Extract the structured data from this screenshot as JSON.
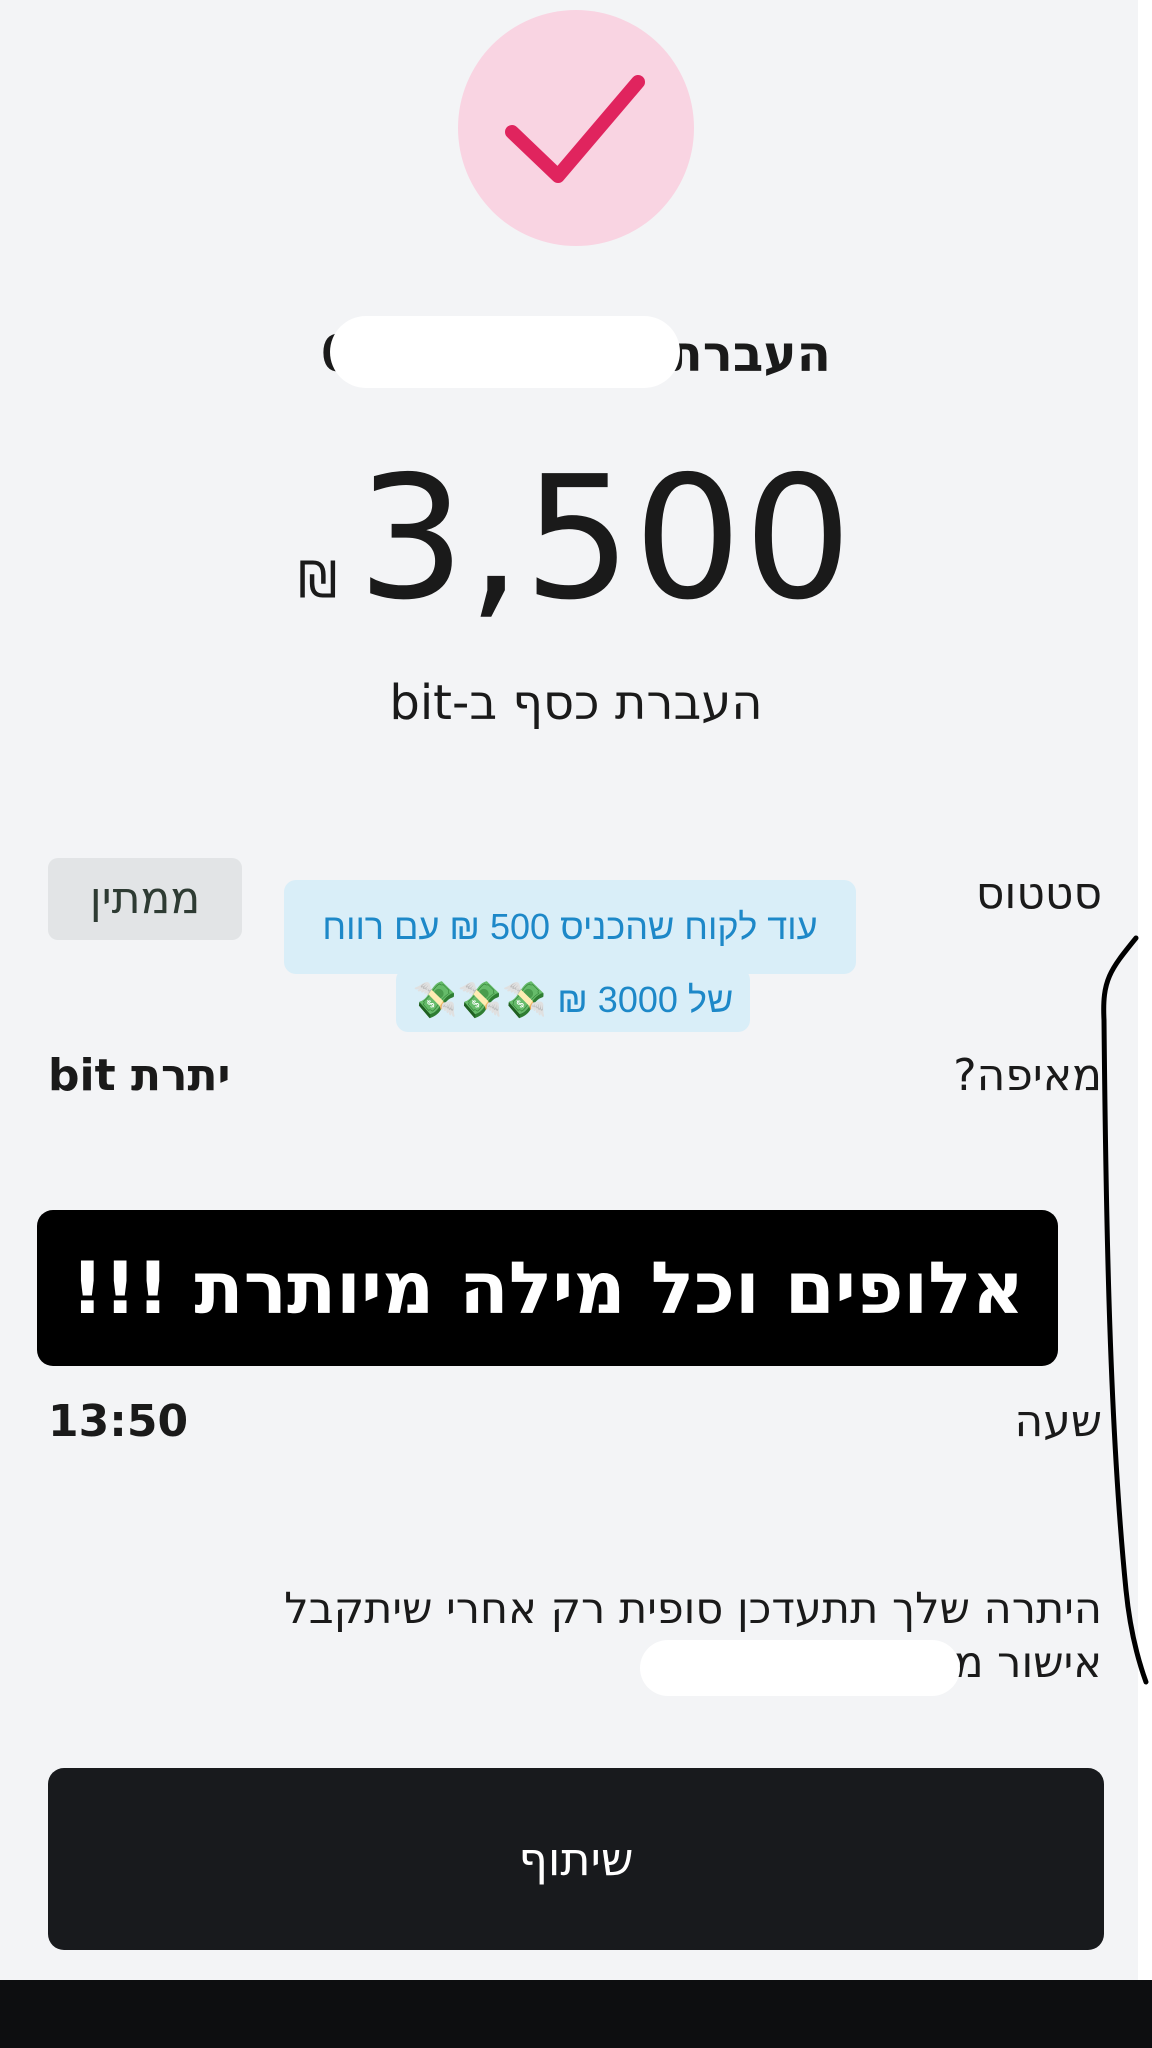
{
  "header": {
    "title": "העברת ל",
    "title_visible_prefix": "05",
    "amount": "3,500",
    "currency": "₪",
    "subtitle": "העברת כסף ב-bit"
  },
  "details": {
    "status_label": "סטטוס",
    "status_value": "ממתין",
    "from_label": "מאיפה?",
    "from_value": "יתרת bit",
    "time_label": "שעה",
    "time_value": "13:50"
  },
  "sticker": {
    "line1": "עוד לקוח שהכניס 500 ₪ עם רווח",
    "line2": "של 3000 ₪ 💸💸💸"
  },
  "overlay": {
    "banner_text": "אלופים וכל מילה מיותרת !!!"
  },
  "info": {
    "text": "היתרה שלך תתעדכן סופית רק אחרי שיתקבל אישור מ"
  },
  "actions": {
    "share_label": "שיתוף"
  },
  "colors": {
    "success_circle": "#f9d4e2",
    "check_mark": "#e0245e",
    "sticker_bg": "#d9eef8",
    "sticker_text": "#1d88c8",
    "button_bg": "#181a1d"
  }
}
